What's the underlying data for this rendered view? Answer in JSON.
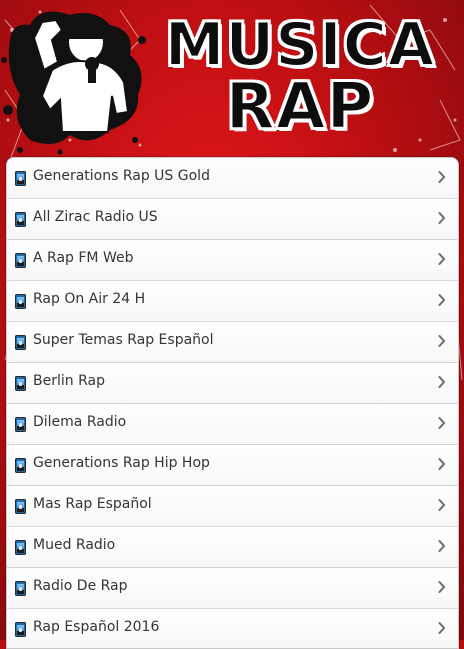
{
  "header": {
    "title_line1": "MUSICA",
    "title_line2": "RAP",
    "rapper_icon": "rapper-graphic",
    "accent_color": "#c91114"
  },
  "stations": [
    {
      "label": "Generations Rap US Gold",
      "icon": "radio-station-icon",
      "chevron": "chevron-right-icon"
    },
    {
      "label": "All Zirac Radio US",
      "icon": "radio-station-icon",
      "chevron": "chevron-right-icon"
    },
    {
      "label": "A Rap FM Web",
      "icon": "radio-station-icon",
      "chevron": "chevron-right-icon"
    },
    {
      "label": "Rap On Air 24 H",
      "icon": "radio-station-icon",
      "chevron": "chevron-right-icon"
    },
    {
      "label": "Super Temas Rap Español",
      "icon": "radio-station-icon",
      "chevron": "chevron-right-icon"
    },
    {
      "label": "Berlin Rap",
      "icon": "radio-station-icon",
      "chevron": "chevron-right-icon"
    },
    {
      "label": "Dilema Radio",
      "icon": "radio-station-icon",
      "chevron": "chevron-right-icon"
    },
    {
      "label": "Generations Rap Hip Hop",
      "icon": "radio-station-icon",
      "chevron": "chevron-right-icon"
    },
    {
      "label": "Mas Rap Español",
      "icon": "radio-station-icon",
      "chevron": "chevron-right-icon"
    },
    {
      "label": "Mued Radio",
      "icon": "radio-station-icon",
      "chevron": "chevron-right-icon"
    },
    {
      "label": "Radio De Rap",
      "icon": "radio-station-icon",
      "chevron": "chevron-right-icon"
    },
    {
      "label": "Rap Español 2016",
      "icon": "radio-station-icon",
      "chevron": "chevron-right-icon"
    }
  ]
}
